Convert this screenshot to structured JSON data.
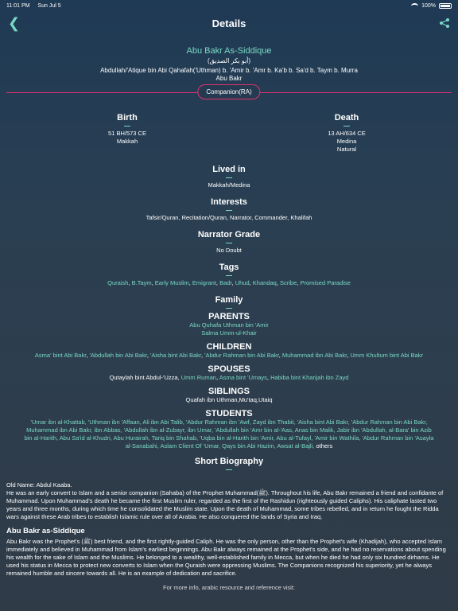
{
  "status": {
    "time": "11:01 PM",
    "date": "Sun Jul 5",
    "battery": "100%"
  },
  "nav": {
    "title": "Details"
  },
  "person": {
    "name": "Abu Bakr As-Siddique",
    "arabic_name": "(أبو بكر الصديق)",
    "lineage_1": "Abdullah/'Atique bin Abi Qahafah('Uthman) b. 'Amir b. 'Amr b. Ka'b b. Sa'd b. Taym b. Murra",
    "lineage_2": "Abu Bakr",
    "badge": "Companion(RA)"
  },
  "birth": {
    "title": "Birth",
    "line1": "51 BH/573 CE",
    "line2": "Makkah"
  },
  "death": {
    "title": "Death",
    "line1": "13 AH/634 CE",
    "line2": "Medina",
    "line3": "Natural"
  },
  "lived_in": {
    "title": "Lived in",
    "value": "Makkah/Medina"
  },
  "interests": {
    "title": "Interests",
    "value": "Tafsir/Quran, Recitation/Quran, Narrator, Commander, Khalifah"
  },
  "narrator_grade": {
    "title": "Narrator Grade",
    "value": "No Doubt"
  },
  "tags": {
    "title": "Tags",
    "items": [
      "Quraish",
      "B.Taym",
      "Early Muslim",
      "Emigrant",
      "Badr",
      "Uhud",
      "Khandaq",
      "Scribe",
      "Promised Paradise"
    ]
  },
  "family": {
    "title": "Family"
  },
  "parents": {
    "title": "PARENTS",
    "father": "Abu Quhafa Uthman bin 'Amir",
    "mother": "Salma Umm-ul-Khair"
  },
  "children": {
    "title": "CHILDREN",
    "items": [
      "Asma' bint Abi Bakr",
      "'Abdullah bin Abi Bakr",
      "'Aisha bint Abi Bakr",
      "'Abdur Rahman bin Abi Bakr",
      "Muhammad ibn Abi Bakr",
      "Umm Khultum bint Abi Bakr"
    ]
  },
  "spouses": {
    "title": "SPOUSES",
    "plain": "Qutaylah bint Abdul-'Uzza,",
    "items": [
      "Umm Ruman",
      "Asma bint 'Umays",
      "Habiba bint Kharijah ibn Zayd"
    ]
  },
  "siblings": {
    "title": "SIBLINGS",
    "value": "Quafah ibn Uthman,Mu'taq,Utaiq"
  },
  "students": {
    "title": "STUDENTS",
    "line1": "'Umar ibn al-Khattab, 'Uthman ibn 'Affaan, Ali ibn Abi Talib, 'Abdur Rahman ibn 'Awf, Zayd ibn Thabit, 'Aisha bint Abi Bakr, 'Abdur Rahman bin Abi Bakr,",
    "line2": "Muhammad ibn Abi Bakr, ibn Abbas, 'Abdullah ibn al-Zubayr, ibn Umar, 'Abdullah bin 'Amr bin al-'Aas, Anas bin Malik, Jabir ibn 'Abdullah, al-Bara' bin Azib",
    "line3": "bin al-Harith, Abu Sa'id al-Khudri, Abu Hurairah, Tariq bin Shahab, 'Uqba bin al-Harith bin 'Amir, Abu al-Tufayl, 'Amir bin Wathila, 'Abdur Rahman bin 'Asayla",
    "line4": "al-Sanabahi, Aslam Client Of 'Umar, Qays bin Abi Hazim, Awsat al-Bajli,",
    "others": "others"
  },
  "biography": {
    "title": "Short Biography",
    "old_name": "Old Name: Abdul Kaaba.",
    "para1": "He was an early convert to Islam and a senior companion (Sahaba) of the Prophet Muhammad(ﷺ). Throughout his life, Abu Bakr remained a friend and confidante of Muhammad. Upon Muhammad's death he became the first Muslim ruler, regarded as the first of the Rashidun (righteously guided Caliphs). His caliphate lasted two years and three months, during which time he consolidated the Muslim state. Upon the death of Muhammad, some tribes rebelled, and in return he fought the Ridda wars against these Arab tribes to establish Islamic rule over all of Arabia. He also conquered the lands of Syria and Iraq.",
    "heading2": "Abu Bakr as-Siddique",
    "para2": "Abu Bakr was the Prophet's (ﷺ) best friend, and the first rightly-guided Caliph. He was the only person, other than the Prophet's wife (Khadijah), who accepted Islam immediately and believed in Muhammad from Islam's earliest beginnings. Abu Bakr always remained at the Prophet's side, and he had no reservations about spending his wealth for the sake of Islam and the Muslims. He belonged to a wealthy, well-established family in Mecca, but when he died he had only six hundred dirhams. He used his status in Mecca to protect new converts to Islam when the Quraish were oppressing Muslims. The Companions recognized his superiority, yet he always remained humble and sincere towards all. He is an example of dedication and sacrifice.",
    "footer": "For more info, arabic resource and reference visit:"
  },
  "colors": {
    "accent": "#79d9c4",
    "badge_border": "#e3306f"
  }
}
